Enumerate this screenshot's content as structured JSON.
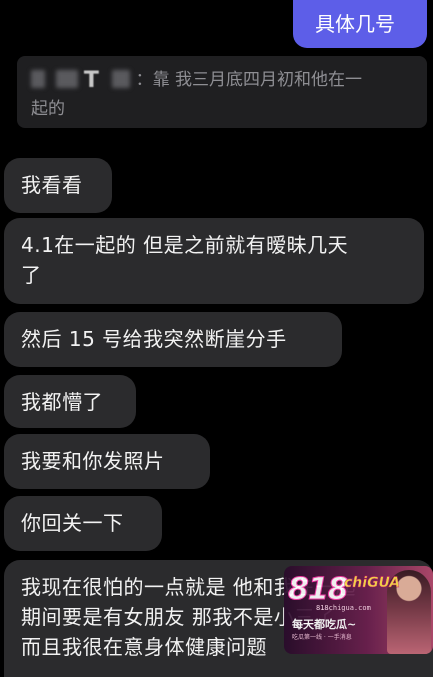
{
  "chat": {
    "sent": [
      {
        "text": "具体几号"
      }
    ],
    "quote": {
      "sender_visible": "T",
      "text_line1": "：靠 我三月底四月初和他在一",
      "text_line2": "起的"
    },
    "received": [
      {
        "line1": "我看看"
      },
      {
        "line1": "4.1在一起的 但是之前就有暧昧几天",
        "line2": "了"
      },
      {
        "line1": "然后 15 号给我突然断崖分手"
      },
      {
        "line1": "我都懵了"
      },
      {
        "line1": "我要和你发照片"
      },
      {
        "line1": "你回关一下"
      },
      {
        "line1": "我现在很怕的一点就是 他和我在一起",
        "line2": "期间要是有女朋友 那我不是小三了",
        "line3": "而且我很在意身体健康问题"
      }
    ]
  },
  "watermark": {
    "logo": "818",
    "logo_sub": "chiGUA",
    "url": "818chigua.com",
    "slogan": "每天都吃瓜~",
    "small": "吃瓜第一线 · 一手消息"
  },
  "colors": {
    "background": "#000000",
    "received_bubble": "#2b2b2d",
    "sent_bubble": "#5d5ee8",
    "quote_bg": "#1f1f21",
    "quote_text": "#8e8e93"
  }
}
